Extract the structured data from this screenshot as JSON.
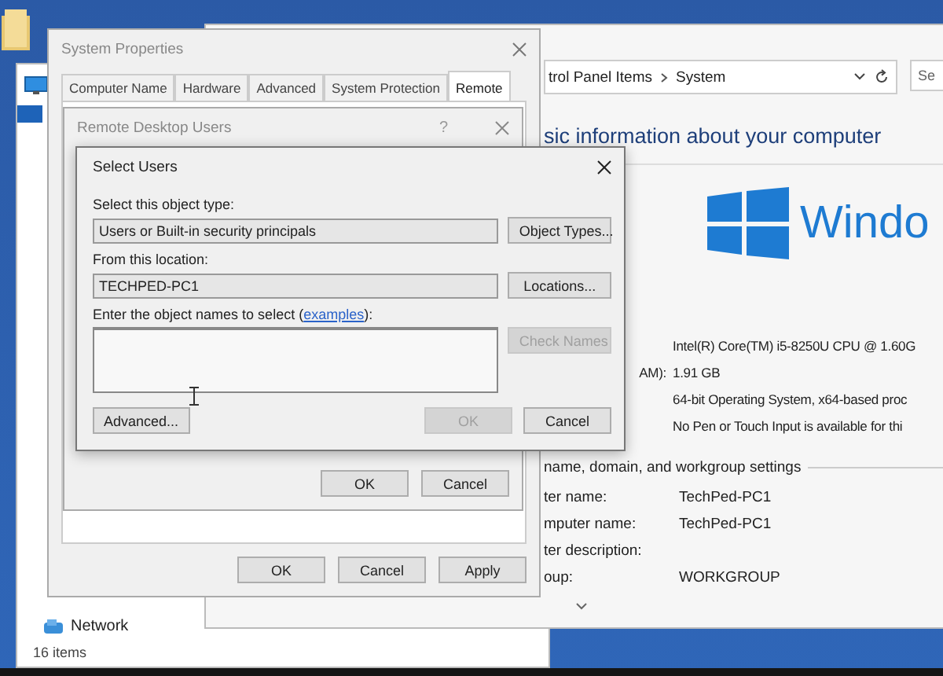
{
  "explorer_window": {
    "nav_items": [
      {
        "label": "Network"
      }
    ],
    "status_bar": "16 items"
  },
  "system_window": {
    "address": {
      "crumbs": [
        "trol Panel Items",
        "System"
      ]
    },
    "search": {
      "placeholder": "Se"
    },
    "heading": "sic information about your computer",
    "logo_text": "Windo",
    "system_rows": [
      {
        "value": "Intel(R) Core(TM) i5-8250U CPU @ 1.60G"
      },
      {
        "label": "AM):",
        "value": "1.91 GB"
      },
      {
        "value": "64-bit Operating System, x64-based proc"
      },
      {
        "value": "No Pen or Touch Input is available for thi"
      }
    ],
    "section_title": "name, domain, and workgroup settings",
    "name_rows": [
      {
        "label": "ter name:",
        "value": "TechPed-PC1"
      },
      {
        "label": "mputer name:",
        "value": "TechPed-PC1"
      },
      {
        "label": "ter description:"
      },
      {
        "label": "oup:",
        "value": "WORKGROUP"
      }
    ]
  },
  "system_properties": {
    "title": "System Properties",
    "tabs": [
      {
        "label": "Computer Name",
        "selected": false
      },
      {
        "label": "Hardware",
        "selected": false
      },
      {
        "label": "Advanced",
        "selected": false
      },
      {
        "label": "System Protection",
        "selected": false
      },
      {
        "label": "Remote",
        "selected": true
      }
    ],
    "buttons": [
      {
        "label": "OK",
        "disabled": false
      },
      {
        "label": "Cancel",
        "disabled": false
      },
      {
        "label": "Apply",
        "disabled": false
      }
    ]
  },
  "remote_desktop_users": {
    "title": "Remote Desktop Users",
    "help": "?",
    "buttons": [
      {
        "label": "OK",
        "disabled": false
      },
      {
        "label": "Cancel",
        "disabled": false
      }
    ]
  },
  "select_users": {
    "title": "Select Users",
    "object_type_label": "Select this object type:",
    "object_type_value": "Users or Built-in security principals",
    "object_types_button": "Object Types...",
    "location_label": "From this location:",
    "location_value": "TECHPED-PC1",
    "locations_button": "Locations...",
    "names_label": {
      "before": "Enter the object names to select (",
      "link": "examples",
      "after": "):"
    },
    "check_names": {
      "label": "Check Names",
      "disabled": true
    },
    "buttons": [
      {
        "label": "Advanced...",
        "disabled": false
      },
      {
        "label": "OK",
        "disabled": true
      },
      {
        "label": "Cancel",
        "disabled": false
      }
    ]
  }
}
